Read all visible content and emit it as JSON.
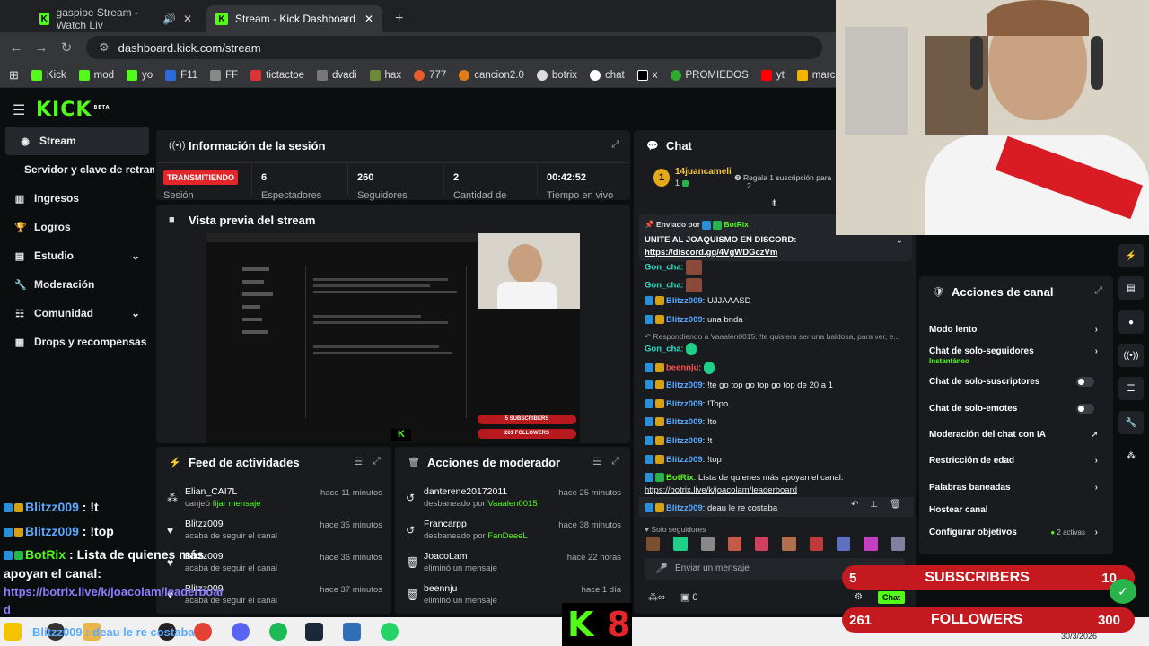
{
  "browser": {
    "tabs": [
      {
        "label": "gaspipe Stream - Watch Liv"
      },
      {
        "label": "Stream - Kick Dashboard"
      }
    ],
    "new_tab": "+",
    "url": "dashboard.kick.com/stream",
    "bookmarks": [
      "Kick",
      "mod",
      "yo",
      "F11",
      "FF",
      "tictactoe",
      "dvadi",
      "hax",
      "777",
      "cancion2.0",
      "botrix",
      "chat",
      "x",
      "PROMIEDOS",
      "yt",
      "marcadores"
    ]
  },
  "kick": {
    "logo": "KICK",
    "beta": "BETA"
  },
  "sidebar": {
    "items": [
      {
        "label": "Stream",
        "icon": "radio-icon"
      },
      {
        "label": "Servidor y clave de retransmisión"
      },
      {
        "label": "Ingresos",
        "icon": "chart-icon"
      },
      {
        "label": "Logros",
        "icon": "trophy-icon"
      },
      {
        "label": "Estudio",
        "icon": "studio-icon"
      },
      {
        "label": "Moderación",
        "icon": "wrench-icon"
      },
      {
        "label": "Comunidad",
        "icon": "community-icon"
      },
      {
        "label": "Drops y recompensas",
        "icon": "drops-icon"
      }
    ]
  },
  "session": {
    "title": "Información de la sesión",
    "status": "TRANSMITIENDO",
    "status_label": "Sesión",
    "stats": [
      {
        "value": "6",
        "label": "Espectadores"
      },
      {
        "value": "260",
        "label": "Seguidores"
      },
      {
        "value": "2",
        "label": "Cantidad de"
      },
      {
        "value": "00:42:52",
        "label": "Tiempo en vivo"
      }
    ]
  },
  "preview": {
    "title": "Vista previa del stream",
    "subs": "SUBSCRIBERS",
    "followers": "FOLLOWERS",
    "subs_num": "5",
    "foll_num": "261"
  },
  "feed": {
    "title": "Feed de actividades",
    "items": [
      {
        "name": "Elian_CAI7L",
        "desc_pre": "canjeó ",
        "desc_hl": "fijar mensaje",
        "time": "hace 11 minutos"
      },
      {
        "name": "Blitzz009",
        "desc_pre": "acaba de seguir el canal",
        "desc_hl": "",
        "time": "hace 35 minutos"
      },
      {
        "name": "Blitzz009",
        "desc_pre": "acaba de seguir el canal",
        "desc_hl": "",
        "time": "hace 36 minutos"
      },
      {
        "name": "Blitzz009",
        "desc_pre": "acaba de seguir el canal",
        "desc_hl": "",
        "time": "hace 37 minutos"
      }
    ]
  },
  "modactions": {
    "title": "Acciones de moderador",
    "items": [
      {
        "name": "danterene20172011",
        "desc_pre": "desbaneado por ",
        "desc_hl": "Vaaalen0015",
        "time": "hace 25 minutos"
      },
      {
        "name": "Francarpp",
        "desc_pre": "desbaneado por ",
        "desc_hl": "FanDeeeL",
        "time": "hace 38 minutos"
      },
      {
        "name": "JoacoLam",
        "desc_pre": "eliminó un mensaje",
        "desc_hl": "",
        "time": "hace 22 horas"
      },
      {
        "name": "beennju",
        "desc_pre": "eliminó un mensaje",
        "desc_hl": "",
        "time": "hace 1 día"
      }
    ]
  },
  "chat": {
    "title": "Chat",
    "sub_user": "14juancameli",
    "sub_count": "1",
    "sub_text": "Regala 1 suscripción para",
    "sub_num": "2",
    "pinned": {
      "by_label": "Enviado por",
      "by": "BotRix",
      "text": "UNITE AL JOAQUISMO EN DISCORD:",
      "link": "https://discord.gg/4VgWDGczVm"
    },
    "messages": [
      {
        "user": "Gon_cha",
        "text": "",
        "style": "u-cyan"
      },
      {
        "user": "Gon_cha",
        "text": "",
        "style": "u-cyan"
      },
      {
        "user": "Blitzz009",
        "text": "UJJAAASD",
        "style": "u-blue"
      },
      {
        "user": "Blitzz009",
        "text": "una bnda",
        "style": "u-blue"
      },
      {
        "user": "Gon_cha",
        "text": "",
        "style": "u-cyan"
      },
      {
        "user": "beennju",
        "text": "",
        "style": "u-red"
      },
      {
        "user": "Blitzz009",
        "text": "!te go top go top go top de 20 a 1",
        "style": "u-blue"
      },
      {
        "user": "Blitzz009",
        "text": "!Topo",
        "style": "u-blue"
      },
      {
        "user": "Blitzz009",
        "text": "!to",
        "style": "u-blue"
      },
      {
        "user": "Blitzz009",
        "text": "!t",
        "style": "u-blue"
      },
      {
        "user": "Blitzz009",
        "text": "!top",
        "style": "u-blue"
      },
      {
        "user": "BotRix",
        "text": "Lista de quienes más apoyan el canal:",
        "style": "u-green"
      },
      {
        "user": "Blitzz009",
        "text": "deau le re costaba",
        "style": "u-blue"
      }
    ],
    "reply_note": "Respondiendo a Vaaalen0015: !te quisiera ser una baldosa, para ver, e...",
    "botrix_link": "https://botrix.live/k/joacolam/leaderboard",
    "followers_only": "Solo seguidores",
    "input_placeholder": "Enviar un mensaje",
    "points": "0",
    "send": "Chat"
  },
  "channel_actions": {
    "title": "Acciones de canal",
    "items": [
      {
        "label": "Modo lento",
        "type": "chev"
      },
      {
        "label": "Chat de solo-seguidores",
        "sub": "Instantáneo",
        "type": "chev"
      },
      {
        "label": "Chat de solo-suscriptores",
        "type": "toggle"
      },
      {
        "label": "Chat de solo-emotes",
        "type": "toggle"
      },
      {
        "label": "Moderación del chat con IA",
        "type": "ext"
      },
      {
        "label": "Restricción de edad",
        "type": "chev"
      },
      {
        "label": "Palabras baneadas",
        "type": "chev"
      },
      {
        "label": "Hostear canal",
        "type": "none"
      },
      {
        "label": "Configurar objetivos",
        "extra": "2 activas",
        "type": "chev"
      }
    ]
  },
  "overlay": {
    "lines": [
      {
        "user": "Blitzz009",
        "text": " : !t"
      },
      {
        "user": "Blitzz009",
        "text": " : !top"
      },
      {
        "user": "BotRix",
        "text": " : Lista de quienes más"
      }
    ],
    "line4": "apoyan el canal:",
    "link1": "https://botrix.live/k/joacolam/leaderboar",
    "link2": "d",
    "bottom": "Blitzz009 : deau le re costaba",
    "subs_label": "SUBSCRIBERS",
    "subs_num": "5",
    "subs_goal": "10",
    "foll_label": "FOLLOWERS",
    "foll_num": "261",
    "foll_goal": "300",
    "brand_k": "K",
    "brand_8": "8"
  },
  "taskbar": {
    "date": "30/3/2026"
  }
}
